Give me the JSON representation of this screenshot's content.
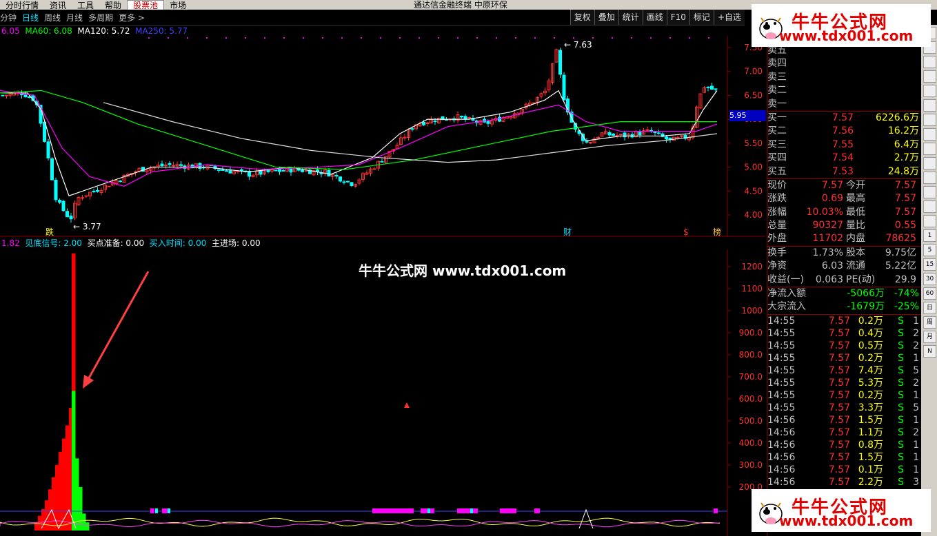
{
  "menubar": {
    "items": [
      "分时行情",
      "资讯",
      "工具",
      "帮助",
      "股票池",
      "市场"
    ],
    "active": "股票池",
    "title": "通达信金融终端 中原环保"
  },
  "toolbar": {
    "left": [
      "分钟",
      "日线",
      "周线",
      "月线",
      "多周期",
      "更多 >"
    ],
    "selected": "日线",
    "right": [
      "复权",
      "叠加",
      "统计",
      "画线",
      "F10",
      "标记",
      "+自选"
    ]
  },
  "ma": {
    "ma_first": "6.05",
    "ma60": "MA60: 6.08",
    "ma120": "MA120: 5.72",
    "ma250": "MA250: 5.77"
  },
  "indicator": {
    "v1": "1.82",
    "signal": "见底信号: 2.00",
    "ready": "买点准备: 0.00",
    "buytime": "买入时间: 0.00",
    "main": "主进场: 0.00"
  },
  "price_axis": [
    "7.50",
    "7.00",
    "6.50",
    "6.00",
    "5.50",
    "5.00",
    "4.50",
    "4.00"
  ],
  "price_badge": "5.95",
  "price_labels": {
    "high": "7.63",
    "low": "3.77",
    "die": "跌",
    "cai": "财",
    "s": "$",
    "bang": "榜"
  },
  "ind_axis": [
    "1200",
    "1100",
    "1000",
    "900.0",
    "800.0",
    "700.0",
    "600.0",
    "500.0",
    "400.0",
    "300.0",
    "200.0"
  ],
  "center_watermark": "牛牛公式网 www.tdx001.com",
  "watermark": {
    "title": "牛牛公式网",
    "url": "www.tdx001.com"
  },
  "quote": {
    "sell": [
      {
        "label": "卖五",
        "price": "",
        "vol": ""
      },
      {
        "label": "卖四",
        "price": "",
        "vol": ""
      },
      {
        "label": "卖三",
        "price": "",
        "vol": ""
      },
      {
        "label": "卖二",
        "price": "",
        "vol": ""
      },
      {
        "label": "卖一",
        "price": "",
        "vol": ""
      }
    ],
    "buy": [
      {
        "label": "买一",
        "price": "7.57",
        "vol": "6226.6万"
      },
      {
        "label": "买二",
        "price": "7.56",
        "vol": "16.2万"
      },
      {
        "label": "买三",
        "price": "7.55",
        "vol": "6.4万"
      },
      {
        "label": "买四",
        "price": "7.54",
        "vol": "2.7万"
      },
      {
        "label": "买五",
        "price": "7.53",
        "vol": "24.8万"
      }
    ],
    "stats": [
      {
        "l1": "现价",
        "v1": "7.57",
        "l2": "今开",
        "v2": "7.57"
      },
      {
        "l1": "涨跌",
        "v1": "0.69",
        "l2": "最高",
        "v2": "7.57"
      },
      {
        "l1": "涨幅",
        "v1": "10.03%",
        "l2": "最低",
        "v2": "7.57"
      },
      {
        "l1": "总量",
        "v1": "90327",
        "l2": "量比",
        "v2": "0.55"
      },
      {
        "l1": "外盘",
        "v1": "11702",
        "l2": "内盘",
        "v2": "78625"
      }
    ],
    "fund": [
      {
        "l1": "换手",
        "v1": "1.73%",
        "l2": "股本",
        "v2": "9.75亿"
      },
      {
        "l1": "净资",
        "v1": "6.03",
        "l2": "流通",
        "v2": "5.22亿"
      },
      {
        "l1": "收益(一)",
        "v1": "0.063",
        "l2": "PE(动)",
        "v2": "29.9"
      }
    ],
    "flow": [
      {
        "label": "净流入额",
        "val": "-5066万",
        "pct": "-74%"
      },
      {
        "label": "大宗流入",
        "val": "-1679万",
        "pct": "-25%"
      }
    ],
    "ticks": [
      {
        "t": "14:55",
        "p": "7.57",
        "v": "0.2万",
        "s": "S",
        "n": "1"
      },
      {
        "t": "14:55",
        "p": "7.57",
        "v": "0.4万",
        "s": "S",
        "n": "2"
      },
      {
        "t": "14:55",
        "p": "7.57",
        "v": "0.5万",
        "s": "S",
        "n": "2"
      },
      {
        "t": "14:55",
        "p": "7.57",
        "v": "0.2万",
        "s": "S",
        "n": "1"
      },
      {
        "t": "14:55",
        "p": "7.57",
        "v": "7.4万",
        "s": "S",
        "n": "5"
      },
      {
        "t": "14:55",
        "p": "7.57",
        "v": "5.3万",
        "s": "S",
        "n": "2"
      },
      {
        "t": "14:55",
        "p": "7.57",
        "v": "0.2万",
        "s": "S",
        "n": "1"
      },
      {
        "t": "14:55",
        "p": "7.57",
        "v": "3.3万",
        "s": "S",
        "n": "5"
      },
      {
        "t": "14:56",
        "p": "7.57",
        "v": "1.5万",
        "s": "S",
        "n": "1"
      },
      {
        "t": "14:56",
        "p": "7.57",
        "v": "1.1万",
        "s": "S",
        "n": "2"
      },
      {
        "t": "14:56",
        "p": "7.57",
        "v": "0.8万",
        "s": "S",
        "n": "1"
      },
      {
        "t": "14:56",
        "p": "7.57",
        "v": "1.5万",
        "s": "S",
        "n": "1"
      },
      {
        "t": "14:56",
        "p": "7.57",
        "v": "0.1万",
        "s": "S",
        "n": "1"
      },
      {
        "t": "14:56",
        "p": "7.57",
        "v": "2.2万",
        "s": "S",
        "n": "3"
      }
    ]
  },
  "sidebar": {
    "labels": [
      "1",
      "5",
      "15",
      "30",
      "60",
      "日",
      "周",
      "月",
      "N"
    ]
  },
  "colors": {
    "up": "#ff3030",
    "down": "#00ffff",
    "accent": "#ffff00",
    "green": "#00ff00",
    "magenta": "#ff00ff"
  }
}
